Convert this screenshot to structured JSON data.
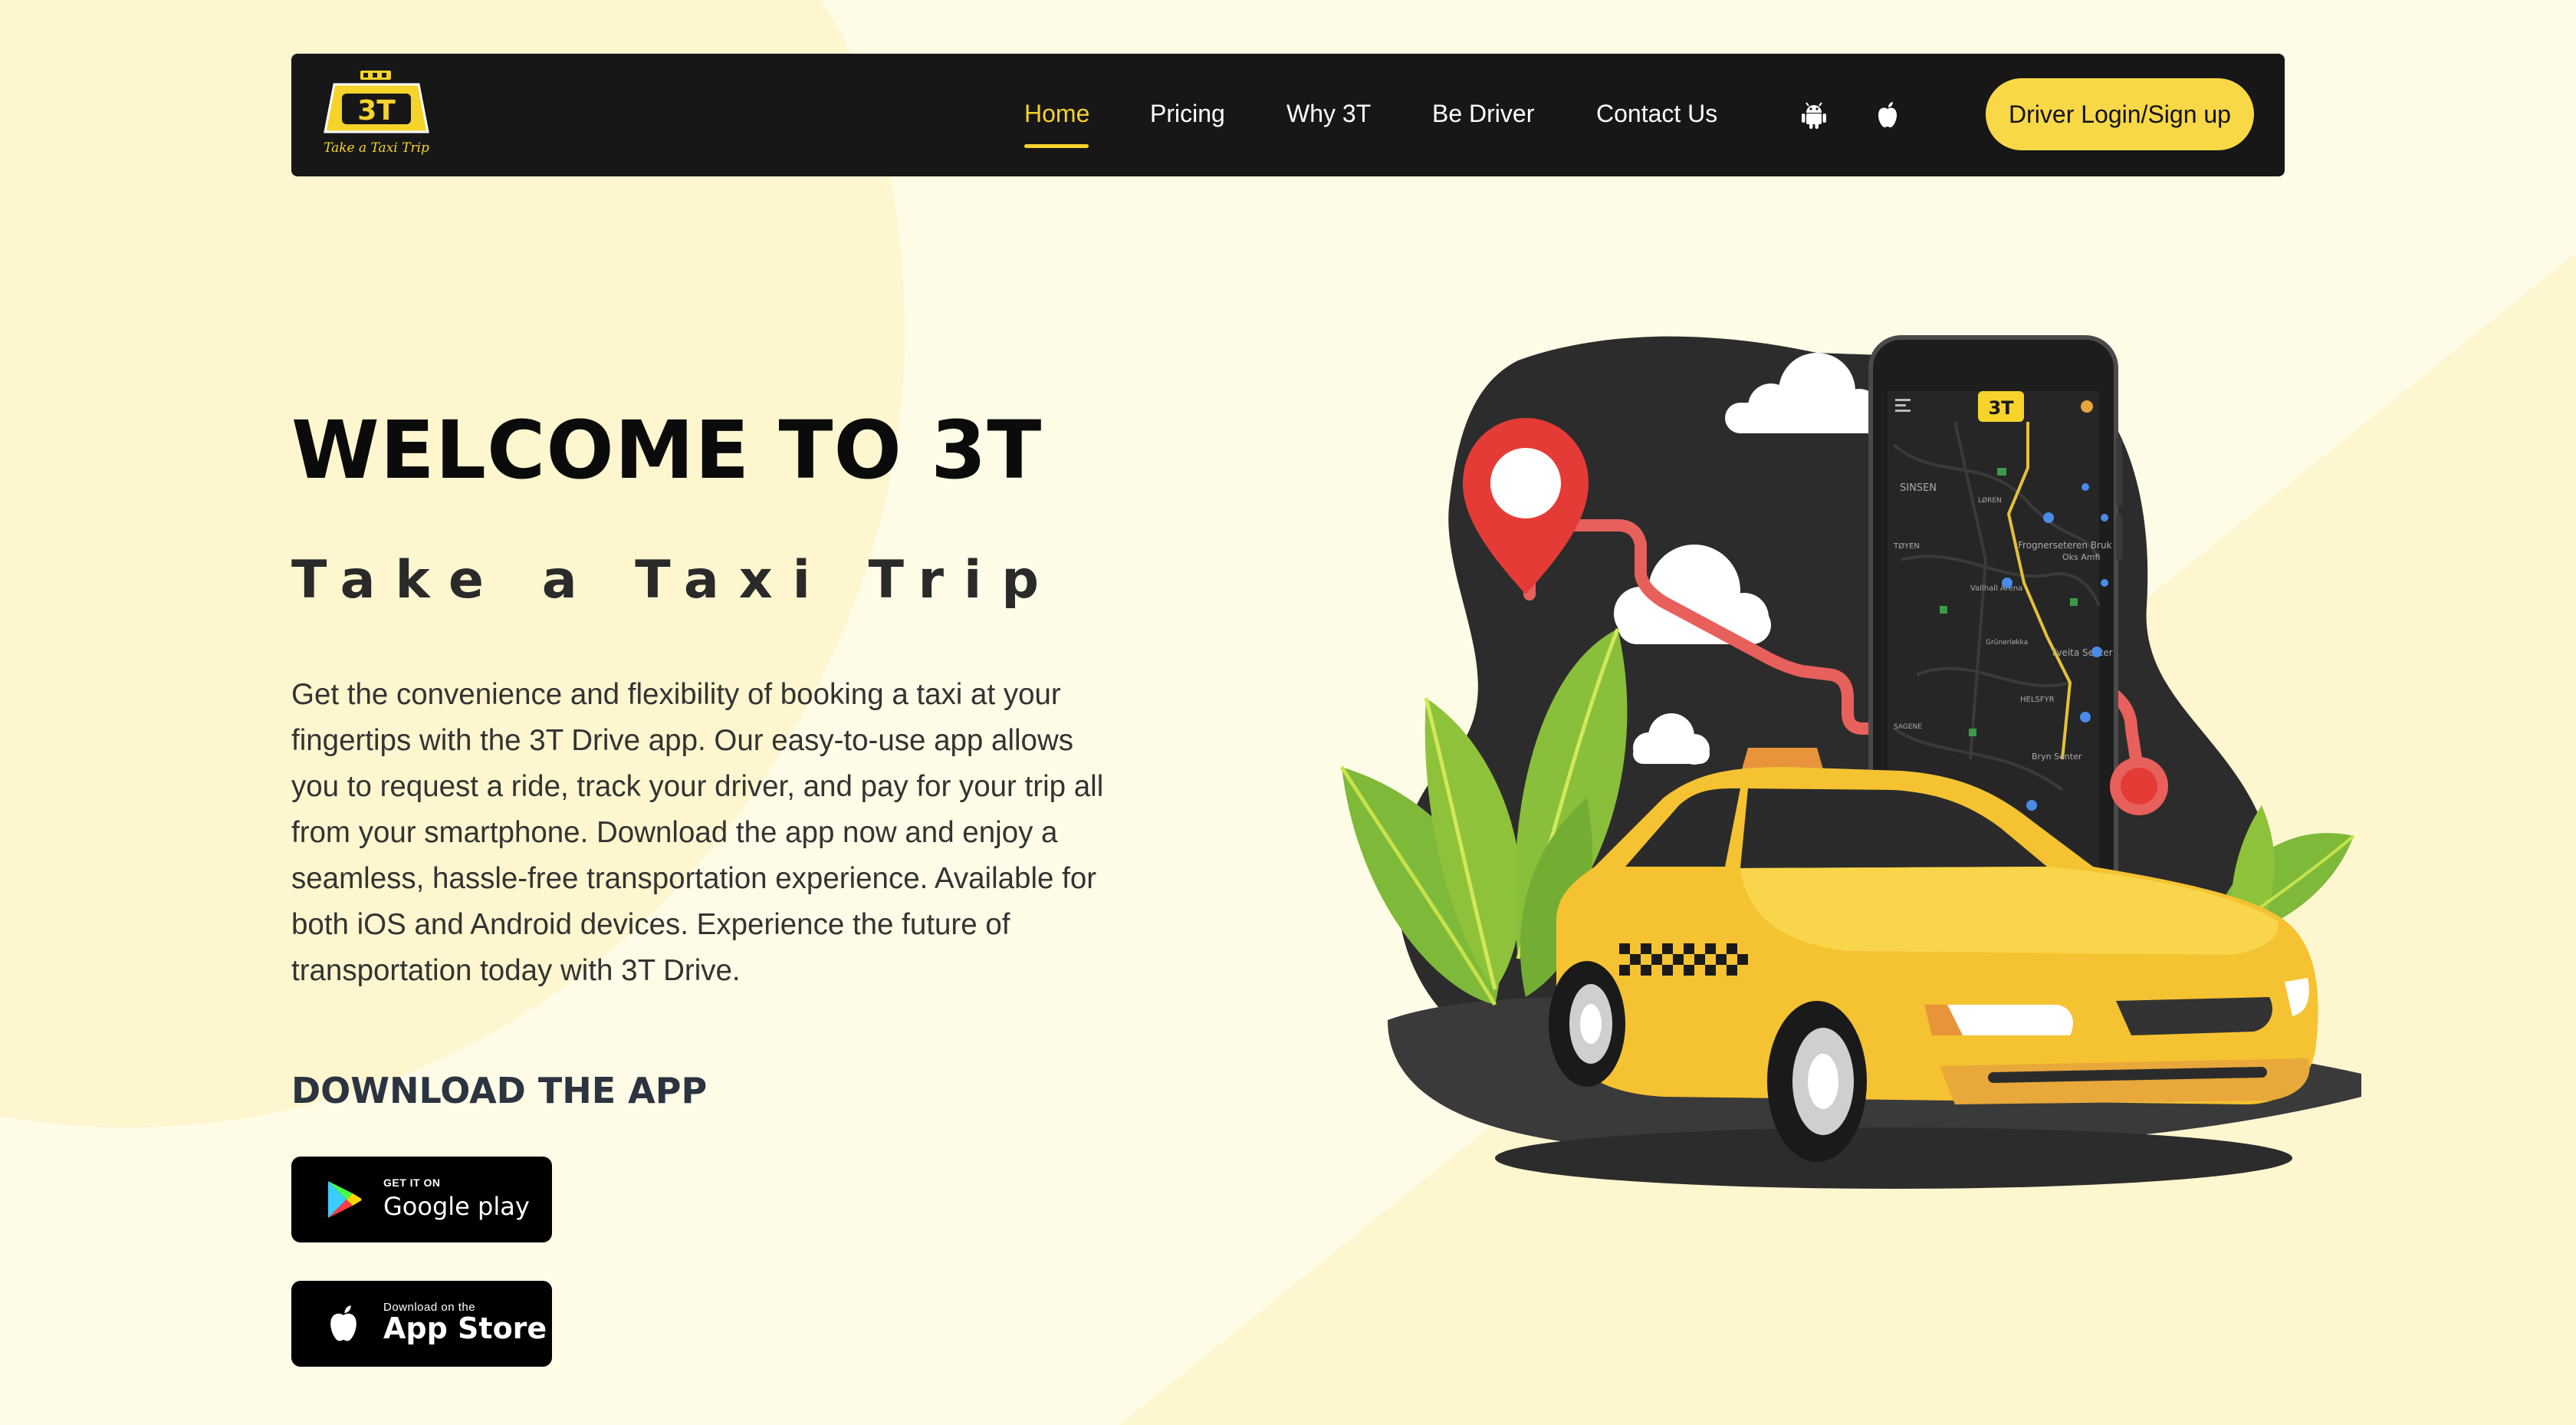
{
  "colors": {
    "background": "#fefbe6",
    "blob": "#fdf6cf",
    "navbar": "#171717",
    "accent": "#f5d32b",
    "button": "#f8d846"
  },
  "brand": {
    "logo_text": "3T",
    "logo_tagline": "Take a Taxi Trip"
  },
  "nav": {
    "items": [
      {
        "label": "Home",
        "active": true
      },
      {
        "label": "Pricing",
        "active": false
      },
      {
        "label": "Why 3T",
        "active": false
      },
      {
        "label": "Be Driver",
        "active": false
      },
      {
        "label": "Contact Us",
        "active": false
      }
    ],
    "icons": [
      "android-icon",
      "apple-icon"
    ],
    "login_label": "Driver Login/Sign up"
  },
  "hero": {
    "title": "WELCOME TO 3T",
    "subtitle": "Take a Taxi Trip",
    "description": "Get the convenience and flexibility of booking a taxi at your fingertips with the 3T Drive app. Our easy-to-use app allows you to request a ride, track your driver, and pay for your trip all from your smartphone. Download the app now and enjoy a seamless, hassle-free transportation experience. Available for both iOS and Android devices. Experience the future of transportation today with 3T Drive."
  },
  "download": {
    "heading": "DOWNLOAD THE APP",
    "google_play": {
      "small": "GET IT ON",
      "big": "Google play"
    },
    "app_store": {
      "small": "Download on the",
      "big": "App Store"
    }
  },
  "illustration": {
    "phone_logo": "3T",
    "map_labels": [
      "SINSEN",
      "LØREN",
      "TØYEN",
      "Frognerseteren Bruk",
      "Vallhall Arena",
      "Grünerløkka",
      "SAGENE",
      "HELSFYR",
      "Bryn Senter",
      "Tveita Senter",
      "Oks Amfi"
    ]
  }
}
